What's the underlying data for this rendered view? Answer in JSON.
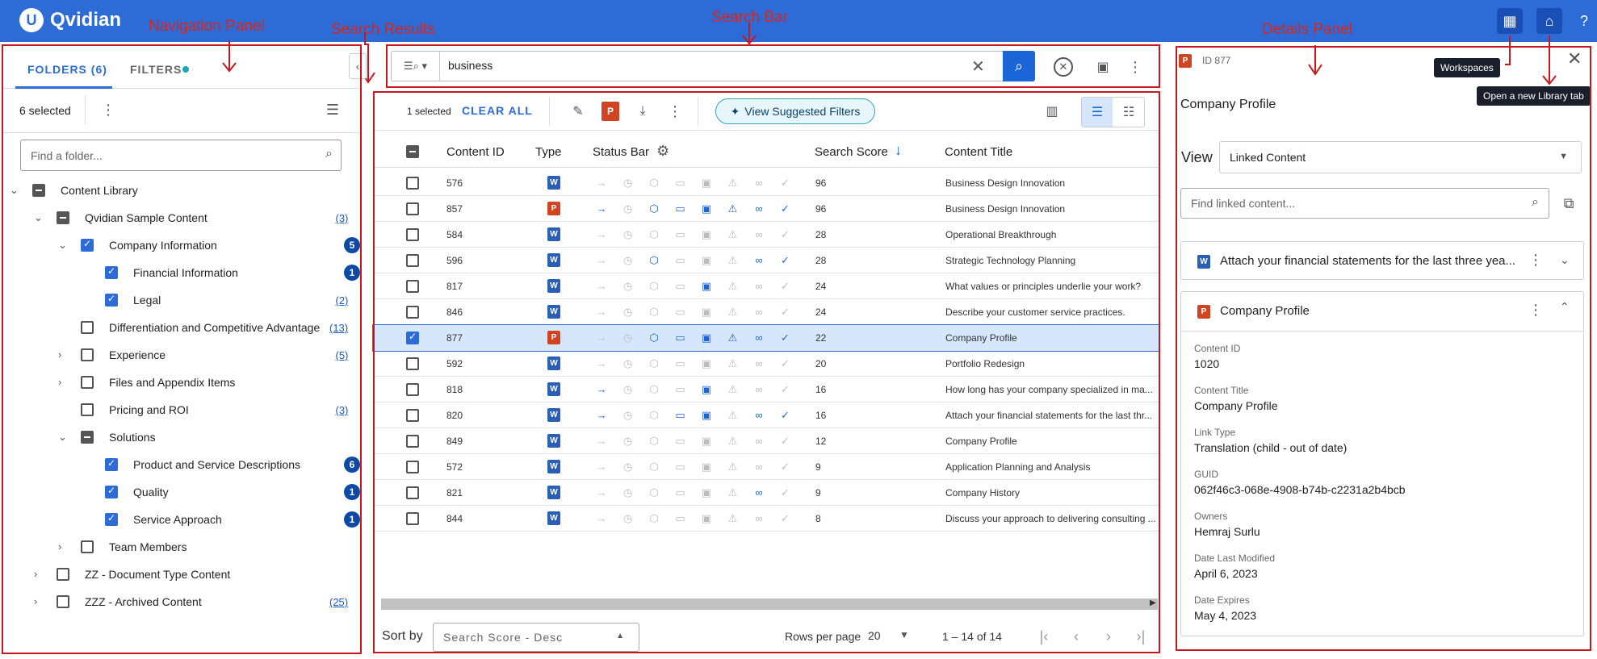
{
  "app": {
    "brand": "Qvidian",
    "brand_mark": "U"
  },
  "annotations": {
    "navigation_panel": "Navigation Panel",
    "search_results": "Search Results",
    "search_bar": "Search Bar",
    "details_panel": "Details Panel"
  },
  "tooltips": {
    "workspaces": "Workspaces",
    "new_library_tab": "Open a new Library tab"
  },
  "nav": {
    "tab_folders": "FOLDERS (6)",
    "tab_filters": "FILTERS",
    "selected_text": "6 selected",
    "find_placeholder": "Find a folder...",
    "tree": [
      {
        "label": "Content Library",
        "state": "mixed",
        "expand": "open",
        "count": ""
      },
      {
        "label": "Qvidian Sample Content",
        "state": "mixed",
        "expand": "open",
        "count": "(3)"
      },
      {
        "label": "Company Information",
        "state": "checked",
        "expand": "open",
        "count": "5"
      },
      {
        "label": "Financial Information",
        "state": "checked",
        "expand": "",
        "count": "1"
      },
      {
        "label": "Legal",
        "state": "checked",
        "expand": "",
        "count": "(2)"
      },
      {
        "label": "Differentiation and Competitive Advantage",
        "state": "unchecked",
        "expand": "",
        "count": "(13)"
      },
      {
        "label": "Experience",
        "state": "unchecked",
        "expand": "closed",
        "count": "(5)"
      },
      {
        "label": "Files and Appendix Items",
        "state": "unchecked",
        "expand": "closed",
        "count": ""
      },
      {
        "label": "Pricing and ROI",
        "state": "unchecked",
        "expand": "",
        "count": "(3)"
      },
      {
        "label": "Solutions",
        "state": "mixed",
        "expand": "open",
        "count": ""
      },
      {
        "label": "Product and Service Descriptions",
        "state": "checked",
        "expand": "",
        "count": "6"
      },
      {
        "label": "Quality",
        "state": "checked",
        "expand": "",
        "count": "1"
      },
      {
        "label": "Service Approach",
        "state": "checked",
        "expand": "",
        "count": "1"
      },
      {
        "label": "Team Members",
        "state": "unchecked",
        "expand": "closed",
        "count": ""
      },
      {
        "label": "ZZ - Document Type Content",
        "state": "unchecked",
        "expand": "closed",
        "count": ""
      },
      {
        "label": "ZZZ - Archived Content",
        "state": "unchecked",
        "expand": "closed",
        "count": "(25)"
      }
    ]
  },
  "search": {
    "query": "business"
  },
  "results": {
    "selected_text": "1 selected",
    "clear_all": "CLEAR ALL",
    "suggested_filters": "View Suggested Filters",
    "columns": {
      "content_id": "Content ID",
      "type": "Type",
      "status_bar": "Status Bar",
      "search_score": "Search Score",
      "content_title": "Content Title"
    },
    "rows": [
      {
        "id": "576",
        "type": "word",
        "score": "96",
        "title": "Business Design Innovation",
        "active": [
          false,
          false,
          false,
          false,
          false,
          false,
          false,
          false
        ],
        "selected": false
      },
      {
        "id": "857",
        "type": "ppt",
        "score": "96",
        "title": "Business Design Innovation",
        "active": [
          true,
          false,
          true,
          true,
          true,
          true,
          true,
          true
        ],
        "selected": false
      },
      {
        "id": "584",
        "type": "word",
        "score": "28",
        "title": "Operational Breakthrough",
        "active": [
          false,
          false,
          false,
          false,
          false,
          false,
          false,
          false
        ],
        "selected": false
      },
      {
        "id": "596",
        "type": "word",
        "score": "28",
        "title": "Strategic Technology Planning",
        "active": [
          false,
          false,
          true,
          false,
          false,
          false,
          true,
          true
        ],
        "selected": false
      },
      {
        "id": "817",
        "type": "word",
        "score": "24",
        "title": "What values or principles underlie your work?",
        "active": [
          false,
          false,
          false,
          false,
          true,
          false,
          false,
          false
        ],
        "selected": false
      },
      {
        "id": "846",
        "type": "word",
        "score": "24",
        "title": "Describe your customer service practices.",
        "active": [
          false,
          false,
          false,
          false,
          false,
          false,
          false,
          false
        ],
        "selected": false
      },
      {
        "id": "877",
        "type": "ppt",
        "score": "22",
        "title": "Company Profile",
        "active": [
          false,
          false,
          true,
          true,
          true,
          true,
          true,
          true
        ],
        "selected": true
      },
      {
        "id": "592",
        "type": "word",
        "score": "20",
        "title": "Portfolio Redesign",
        "active": [
          false,
          false,
          false,
          false,
          false,
          false,
          false,
          false
        ],
        "selected": false
      },
      {
        "id": "818",
        "type": "word",
        "score": "16",
        "title": "How long has your company specialized in ma...",
        "active": [
          true,
          false,
          false,
          false,
          true,
          false,
          false,
          false
        ],
        "selected": false
      },
      {
        "id": "820",
        "type": "word",
        "score": "16",
        "title": "Attach your financial statements for the last thr...",
        "active": [
          true,
          false,
          false,
          true,
          true,
          false,
          true,
          true
        ],
        "selected": false
      },
      {
        "id": "849",
        "type": "word",
        "score": "12",
        "title": "Company Profile",
        "active": [
          false,
          false,
          false,
          false,
          false,
          false,
          false,
          false
        ],
        "selected": false
      },
      {
        "id": "572",
        "type": "word",
        "score": "9",
        "title": "Application Planning and Analysis",
        "active": [
          false,
          false,
          false,
          false,
          false,
          false,
          false,
          false
        ],
        "selected": false
      },
      {
        "id": "821",
        "type": "word",
        "score": "9",
        "title": "Company History",
        "active": [
          false,
          false,
          false,
          false,
          false,
          false,
          true,
          false
        ],
        "selected": false
      },
      {
        "id": "844",
        "type": "word",
        "score": "8",
        "title": "Discuss your approach to delivering consulting ...",
        "active": [
          false,
          false,
          false,
          false,
          false,
          false,
          false,
          false
        ],
        "selected": false
      }
    ],
    "status_icons": [
      "→",
      "◷",
      "⬡",
      "▭",
      "▣",
      "⚠",
      "∞",
      "✓"
    ],
    "sort_by_label": "Sort by",
    "sort_value": "Search Score - Desc",
    "rows_per_page_label": "Rows per page",
    "rows_per_page": "20",
    "pagination": "1 – 14 of 14"
  },
  "details": {
    "id_label": "ID 877",
    "title": "Company Profile",
    "view_label": "View",
    "view_value": "Linked Content",
    "find_placeholder": "Find linked content...",
    "card1_title": "Attach your financial statements for the last three yea...",
    "card2_title": "Company Profile",
    "fields": [
      {
        "label": "Content ID",
        "value": "1020"
      },
      {
        "label": "Content Title",
        "value": "Company Profile"
      },
      {
        "label": "Link Type",
        "value": "Translation (child - out of date)"
      },
      {
        "label": "GUID",
        "value": "062f46c3-068e-4908-b74b-c2231a2b4bcb"
      },
      {
        "label": "Owners",
        "value": "Hemraj Surlu"
      },
      {
        "label": "Date Last Modified",
        "value": "April 6, 2023"
      },
      {
        "label": "Date Expires",
        "value": "May 4, 2023"
      }
    ]
  }
}
